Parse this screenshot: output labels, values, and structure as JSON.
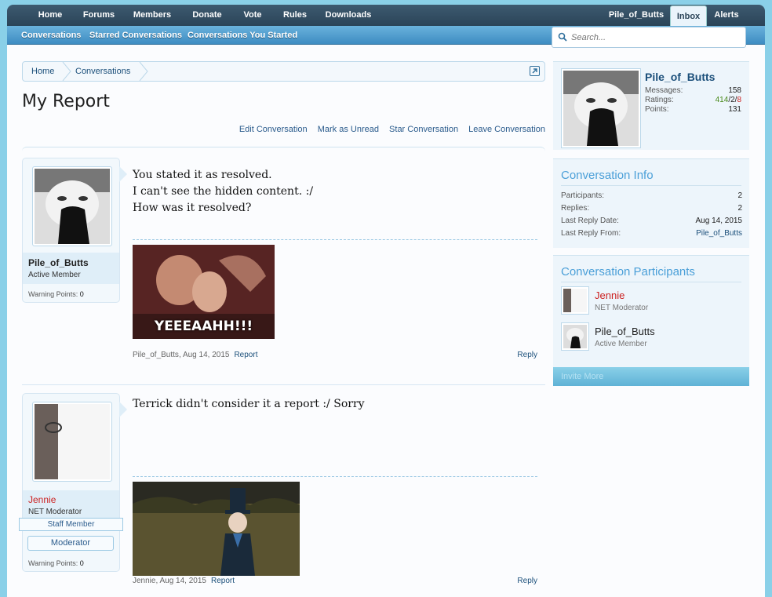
{
  "topnav": {
    "items": [
      "Home",
      "Forums",
      "Members",
      "Donate",
      "Vote",
      "Rules",
      "Downloads"
    ],
    "user": "Pile_of_Butts",
    "inbox": "Inbox",
    "alerts": "Alerts"
  },
  "subnav": [
    "Conversations",
    "Starred Conversations",
    "Conversations You Started"
  ],
  "search": {
    "placeholder": "Search..."
  },
  "breadcrumb": [
    "Home",
    "Conversations"
  ],
  "page": {
    "title": "My Report"
  },
  "actions": [
    "Edit Conversation",
    "Mark as Unread",
    "Star Conversation",
    "Leave Conversation"
  ],
  "messages": [
    {
      "username": "Pile_of_Butts",
      "user_title": "Active Member",
      "warning_label": "Warning Points:",
      "warning_value": "0",
      "lines": [
        "You stated it as resolved.",
        "I can't see the hidden content. :/",
        "How was it resolved?"
      ],
      "image_caption": "YEEEAAHH!!!",
      "author": "Pile_of_Butts",
      "date": "Aug 14, 2015",
      "report": "Report",
      "reply": "Reply"
    },
    {
      "username": "Jennie",
      "user_title": "NET Moderator",
      "staff_label": "Staff Member",
      "badge": "Moderator",
      "warning_label": "Warning Points:",
      "warning_value": "0",
      "lines": [
        "Terrick didn't consider it a report :/ Sorry"
      ],
      "author": "Jennie",
      "date": "Aug 14, 2015",
      "report": "Report",
      "reply": "Reply"
    }
  ],
  "sidebar": {
    "visitor": {
      "name": "Pile_of_Butts",
      "messages_label": "Messages:",
      "messages_value": "158",
      "ratings_label": "Ratings:",
      "ratings_pos": "414",
      "ratings_neu": "2",
      "ratings_neg": "8",
      "points_label": "Points:",
      "points_value": "131"
    },
    "info": {
      "heading": "Conversation Info",
      "participants_label": "Participants:",
      "participants_value": "2",
      "replies_label": "Replies:",
      "replies_value": "2",
      "last_date_label": "Last Reply Date:",
      "last_date_value": "Aug 14, 2015",
      "last_from_label": "Last Reply From:",
      "last_from_value": "Pile_of_Butts"
    },
    "participants": {
      "heading": "Conversation Participants",
      "list": [
        {
          "name": "Jennie",
          "title": "NET Moderator"
        },
        {
          "name": "Pile_of_Butts",
          "title": "Active Member"
        }
      ],
      "invite": "Invite More"
    }
  },
  "colors": {
    "accent": "#4a9fd8",
    "moderator": "#cc2222",
    "link": "#1b4f7a"
  }
}
